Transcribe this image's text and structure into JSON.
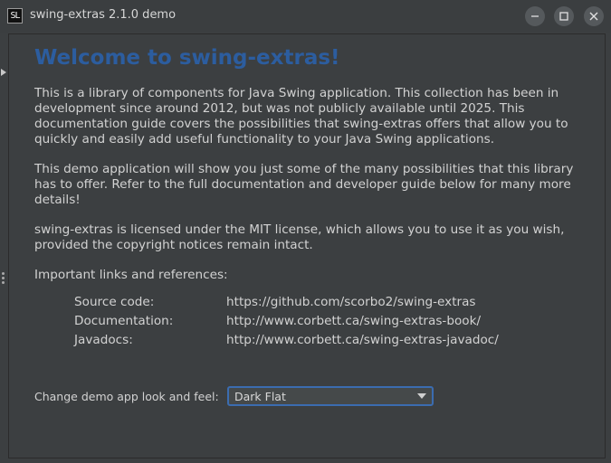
{
  "window": {
    "icon_text": "SL",
    "title": "swing-extras 2.1.0 demo"
  },
  "main": {
    "heading": "Welcome to swing-extras!",
    "paragraphs": [
      "This is a library of components for Java Swing application. This collection has been in development since around 2012, but was not publicly available until 2025. This documentation guide covers the possibilities that swing-extras offers that allow you to quickly and easily add useful functionality to your Java Swing applications.",
      "This demo application will show you just some of the many possibilities that this library has to offer. Refer to the full documentation and developer guide below for many more details!",
      "swing-extras is licensed under the MIT license, which allows you to use it as you wish, provided the copyright notices remain intact.",
      "Important links and references:"
    ],
    "links": [
      {
        "label": "Source code:",
        "value": "https://github.com/scorbo2/swing-extras"
      },
      {
        "label": "Documentation:",
        "value": "http://www.corbett.ca/swing-extras-book/"
      },
      {
        "label": "Javadocs:",
        "value": "http://www.corbett.ca/swing-extras-javadoc/"
      }
    ],
    "laf_label": "Change demo app look and feel:",
    "laf_selected": "Dark Flat"
  },
  "colors": {
    "heading": "#2c5d9f",
    "background": "#3c3f41",
    "select_border": "#3b6cb0"
  },
  "icons": [
    "app-icon",
    "minimize-icon",
    "maximize-icon",
    "close-icon",
    "arrow-right-icon",
    "grip-icon",
    "chevron-down-icon"
  ]
}
